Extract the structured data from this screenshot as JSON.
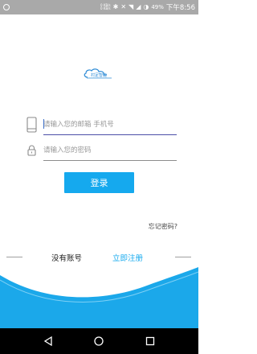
{
  "status_bar": {
    "net_speed_up": "0 KB/s",
    "net_speed_down": "0 KB/s",
    "battery": "49%",
    "time": "下午8:56"
  },
  "logo": {
    "text": "村足智能"
  },
  "form": {
    "account_placeholder": "请输入您的邮箱 手机号",
    "password_placeholder": "请输入您的密码",
    "login_label": "登录",
    "forgot_label": "忘记密码?"
  },
  "footer": {
    "no_account": "没有账号",
    "register": "立即注册"
  },
  "colors": {
    "accent": "#15a9ee",
    "wave": "#1ba8ea"
  }
}
